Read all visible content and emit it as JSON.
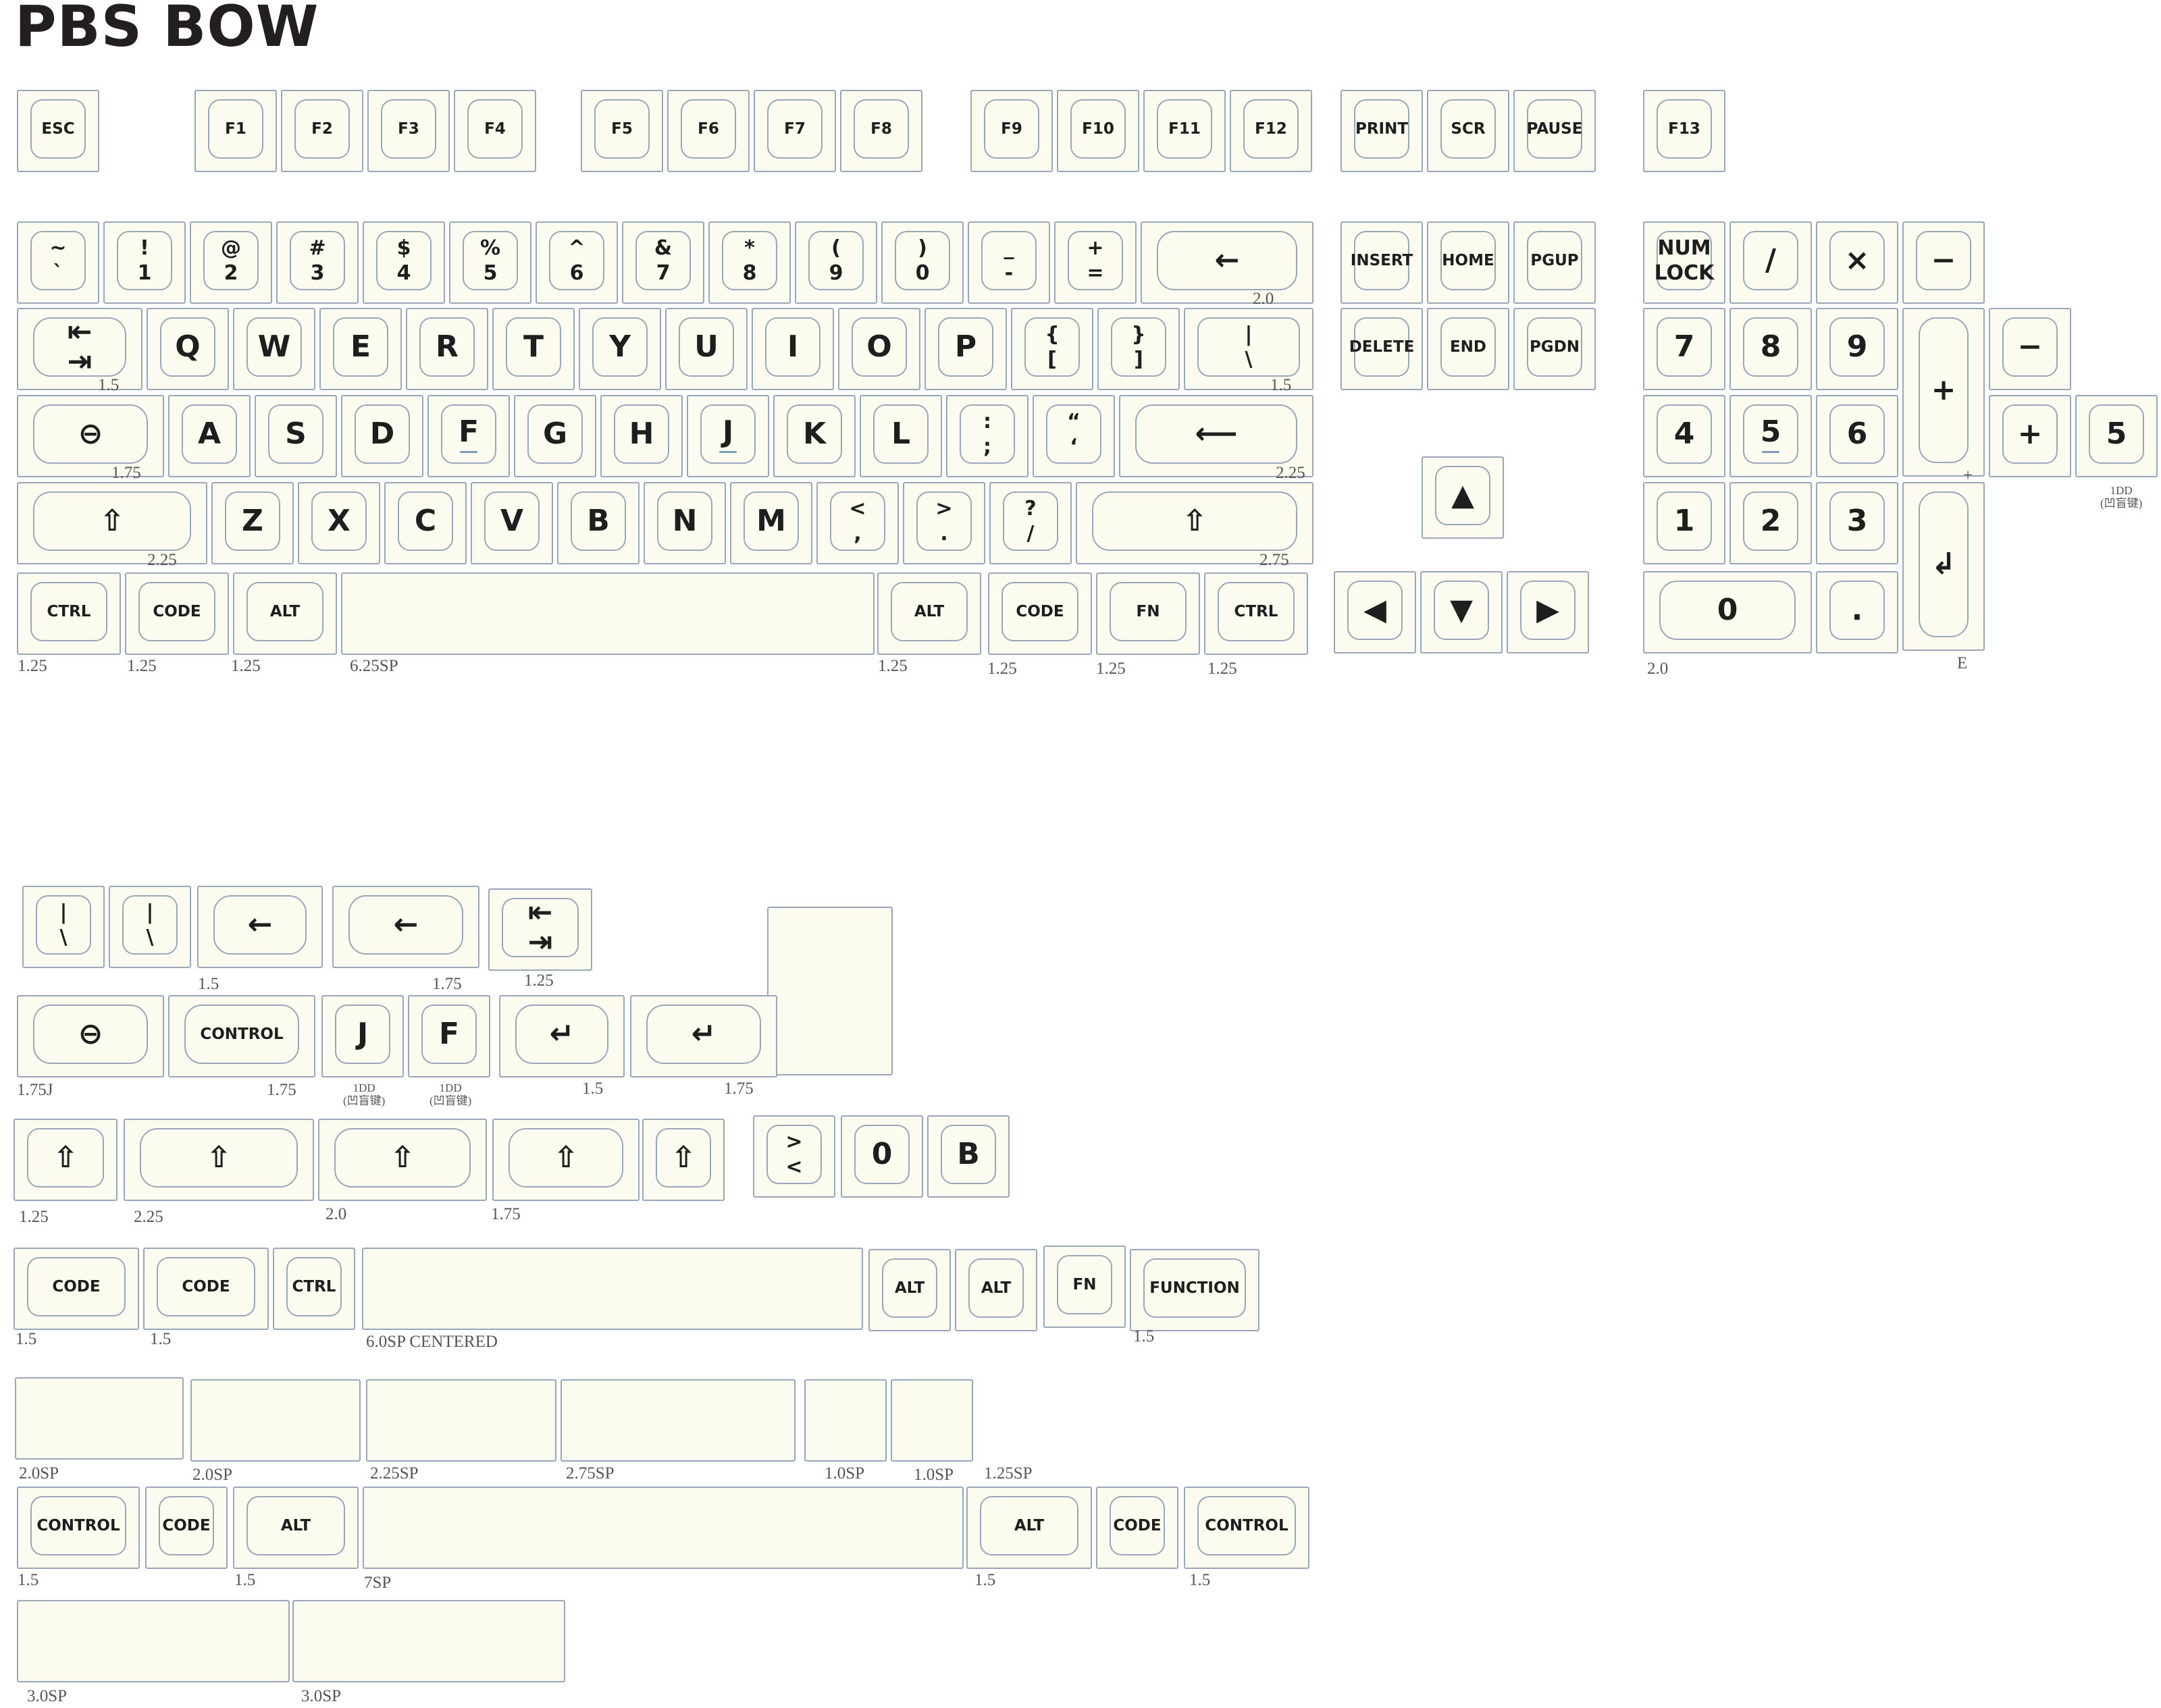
{
  "title": "PBS BOW",
  "colors": {
    "keycap": "#fcfbf0",
    "outline": "#9aa7b8",
    "homing_bar": "#7e9bb8",
    "text": "#1e1e1e"
  },
  "icons": {
    "shift": "⇧",
    "backspace": "←",
    "enter": "↵",
    "enter_long": "⟵",
    "tab_top": "⇤",
    "tab_bottom": "⇥",
    "caps_lock": "⊖",
    "arrow_up": "▲",
    "arrow_down": "▼",
    "arrow_left": "◀",
    "arrow_right": "▶",
    "numpad_enter": "↲"
  },
  "keys": [
    {
      "legends": [
        "ESC"
      ],
      "icon_name": "",
      "homing": false
    },
    {
      "legends": [
        "F1"
      ],
      "icon_name": "",
      "homing": false
    },
    {
      "legends": [
        "F2"
      ],
      "icon_name": "",
      "homing": false
    },
    {
      "legends": [
        "F3"
      ],
      "icon_name": "",
      "homing": false
    },
    {
      "legends": [
        "F4"
      ],
      "icon_name": "",
      "homing": false
    },
    {
      "legends": [
        "F5"
      ],
      "icon_name": "",
      "homing": false
    },
    {
      "legends": [
        "F6"
      ],
      "icon_name": "",
      "homing": false
    },
    {
      "legends": [
        "F7"
      ],
      "icon_name": "",
      "homing": false
    },
    {
      "legends": [
        "F8"
      ],
      "icon_name": "",
      "homing": false
    },
    {
      "legends": [
        "F9"
      ],
      "icon_name": "",
      "homing": false
    },
    {
      "legends": [
        "F10"
      ],
      "icon_name": "",
      "homing": false
    },
    {
      "legends": [
        "F11"
      ],
      "icon_name": "",
      "homing": false
    },
    {
      "legends": [
        "F12"
      ],
      "icon_name": "",
      "homing": false
    },
    {
      "legends": [
        "PRINT"
      ],
      "icon_name": "",
      "homing": false
    },
    {
      "legends": [
        "SCR"
      ],
      "icon_name": "",
      "homing": false
    },
    {
      "legends": [
        "PAUSE"
      ],
      "icon_name": "",
      "homing": false
    },
    {
      "legends": [
        "F13"
      ],
      "icon_name": "",
      "homing": false
    },
    {
      "legends": [
        "~",
        "`"
      ],
      "icon_name": "",
      "homing": false
    },
    {
      "legends": [
        "!",
        "1"
      ],
      "icon_name": "",
      "homing": false
    },
    {
      "legends": [
        "@",
        "2"
      ],
      "icon_name": "",
      "homing": false
    },
    {
      "legends": [
        "#",
        "3"
      ],
      "icon_name": "",
      "homing": false
    },
    {
      "legends": [
        "$",
        "4"
      ],
      "icon_name": "",
      "homing": false
    },
    {
      "legends": [
        "%",
        "5"
      ],
      "icon_name": "",
      "homing": false
    },
    {
      "legends": [
        "^",
        "6"
      ],
      "icon_name": "",
      "homing": false
    },
    {
      "legends": [
        "&",
        "7"
      ],
      "icon_name": "",
      "homing": false
    },
    {
      "legends": [
        "*",
        "8"
      ],
      "icon_name": "",
      "homing": false
    },
    {
      "legends": [
        "(",
        "9"
      ],
      "icon_name": "",
      "homing": false
    },
    {
      "legends": [
        ")",
        "0"
      ],
      "icon_name": "",
      "homing": false
    },
    {
      "legends": [
        "_",
        "-"
      ],
      "icon_name": "",
      "homing": false
    },
    {
      "legends": [
        "+",
        "="
      ],
      "icon_name": "",
      "homing": false
    },
    {
      "legends": [
        "←"
      ],
      "icon_name": "backspace-icon",
      "homing": false
    },
    {
      "legends": [
        "INSERT"
      ],
      "icon_name": "",
      "homing": false
    },
    {
      "legends": [
        "HOME"
      ],
      "icon_name": "",
      "homing": false
    },
    {
      "legends": [
        "PGUP"
      ],
      "icon_name": "",
      "homing": false
    },
    {
      "legends": [
        "NUM",
        "LOCK"
      ],
      "icon_name": "",
      "homing": false
    },
    {
      "legends": [
        "/"
      ],
      "icon_name": "",
      "homing": false
    },
    {
      "legends": [
        "×"
      ],
      "icon_name": "",
      "homing": false
    },
    {
      "legends": [
        "−"
      ],
      "icon_name": "",
      "homing": false
    },
    {
      "legends": [
        "⇤",
        "⇥"
      ],
      "icon_name": "tab-icon",
      "homing": false
    },
    {
      "legends": [
        "Q"
      ],
      "icon_name": "",
      "homing": false
    },
    {
      "legends": [
        "W"
      ],
      "icon_name": "",
      "homing": false
    },
    {
      "legends": [
        "E"
      ],
      "icon_name": "",
      "homing": false
    },
    {
      "legends": [
        "R"
      ],
      "icon_name": "",
      "homing": false
    },
    {
      "legends": [
        "T"
      ],
      "icon_name": "",
      "homing": false
    },
    {
      "legends": [
        "Y"
      ],
      "icon_name": "",
      "homing": false
    },
    {
      "legends": [
        "U"
      ],
      "icon_name": "",
      "homing": false
    },
    {
      "legends": [
        "I"
      ],
      "icon_name": "",
      "homing": false
    },
    {
      "legends": [
        "O"
      ],
      "icon_name": "",
      "homing": false
    },
    {
      "legends": [
        "P"
      ],
      "icon_name": "",
      "homing": false
    },
    {
      "legends": [
        "{",
        "["
      ],
      "icon_name": "",
      "homing": false
    },
    {
      "legends": [
        "}",
        "]"
      ],
      "icon_name": "",
      "homing": false
    },
    {
      "legends": [
        "|",
        "\\"
      ],
      "icon_name": "",
      "homing": false
    },
    {
      "legends": [
        "DELETE"
      ],
      "icon_name": "",
      "homing": false
    },
    {
      "legends": [
        "END"
      ],
      "icon_name": "",
      "homing": false
    },
    {
      "legends": [
        "PGDN"
      ],
      "icon_name": "",
      "homing": false
    },
    {
      "legends": [
        "7"
      ],
      "icon_name": "",
      "homing": false
    },
    {
      "legends": [
        "8"
      ],
      "icon_name": "",
      "homing": false
    },
    {
      "legends": [
        "9"
      ],
      "icon_name": "",
      "homing": false
    },
    {
      "legends": [
        "+"
      ],
      "icon_name": "",
      "homing": false
    },
    {
      "legends": [
        "−"
      ],
      "icon_name": "",
      "homing": false
    },
    {
      "legends": [
        "⊖"
      ],
      "icon_name": "caps-lock-icon",
      "homing": false
    },
    {
      "legends": [
        "A"
      ],
      "icon_name": "",
      "homing": false
    },
    {
      "legends": [
        "S"
      ],
      "icon_name": "",
      "homing": false
    },
    {
      "legends": [
        "D"
      ],
      "icon_name": "",
      "homing": false
    },
    {
      "legends": [
        "F"
      ],
      "icon_name": "",
      "homing": true
    },
    {
      "legends": [
        "G"
      ],
      "icon_name": "",
      "homing": false
    },
    {
      "legends": [
        "H"
      ],
      "icon_name": "",
      "homing": false
    },
    {
      "legends": [
        "J"
      ],
      "icon_name": "",
      "homing": true
    },
    {
      "legends": [
        "K"
      ],
      "icon_name": "",
      "homing": false
    },
    {
      "legends": [
        "L"
      ],
      "icon_name": "",
      "homing": false
    },
    {
      "legends": [
        ":",
        ";"
      ],
      "icon_name": "",
      "homing": false
    },
    {
      "legends": [
        "“",
        "‘"
      ],
      "icon_name": "",
      "homing": false
    },
    {
      "legends": [
        "⟵"
      ],
      "icon_name": "enter-icon",
      "homing": false
    },
    {
      "legends": [
        "4"
      ],
      "icon_name": "",
      "homing": false
    },
    {
      "legends": [
        "5"
      ],
      "icon_name": "",
      "homing": true
    },
    {
      "legends": [
        "6"
      ],
      "icon_name": "",
      "homing": false
    },
    {
      "legends": [
        "+"
      ],
      "icon_name": "",
      "homing": false
    },
    {
      "legends": [
        "5"
      ],
      "icon_name": "",
      "homing": false
    },
    {
      "legends": [
        "⇧"
      ],
      "icon_name": "shift-icon",
      "homing": false
    },
    {
      "legends": [
        "Z"
      ],
      "icon_name": "",
      "homing": false
    },
    {
      "legends": [
        "X"
      ],
      "icon_name": "",
      "homing": false
    },
    {
      "legends": [
        "C"
      ],
      "icon_name": "",
      "homing": false
    },
    {
      "legends": [
        "V"
      ],
      "icon_name": "",
      "homing": false
    },
    {
      "legends": [
        "B"
      ],
      "icon_name": "",
      "homing": false
    },
    {
      "legends": [
        "N"
      ],
      "icon_name": "",
      "homing": false
    },
    {
      "legends": [
        "M"
      ],
      "icon_name": "",
      "homing": false
    },
    {
      "legends": [
        "<",
        ","
      ],
      "icon_name": "",
      "homing": false
    },
    {
      "legends": [
        ">",
        "."
      ],
      "icon_name": "",
      "homing": false
    },
    {
      "legends": [
        "?",
        "/"
      ],
      "icon_name": "",
      "homing": false
    },
    {
      "legends": [
        "⇧"
      ],
      "icon_name": "shift-icon",
      "homing": false
    },
    {
      "legends": [
        "▲"
      ],
      "icon_name": "arrow-up-icon",
      "homing": false
    },
    {
      "legends": [
        "1"
      ],
      "icon_name": "",
      "homing": false
    },
    {
      "legends": [
        "2"
      ],
      "icon_name": "",
      "homing": false
    },
    {
      "legends": [
        "3"
      ],
      "icon_name": "",
      "homing": false
    },
    {
      "legends": [
        "↲"
      ],
      "icon_name": "numpad-enter-icon",
      "homing": false
    },
    {
      "legends": [
        "CTRL"
      ],
      "icon_name": "",
      "homing": false
    },
    {
      "legends": [
        "CODE"
      ],
      "icon_name": "",
      "homing": false
    },
    {
      "legends": [
        "ALT"
      ],
      "icon_name": "",
      "homing": false
    },
    {
      "legends": [],
      "icon_name": "",
      "homing": false
    },
    {
      "legends": [
        "ALT"
      ],
      "icon_name": "",
      "homing": false
    },
    {
      "legends": [
        "CODE"
      ],
      "icon_name": "",
      "homing": false
    },
    {
      "legends": [
        "FN"
      ],
      "icon_name": "",
      "homing": false
    },
    {
      "legends": [
        "CTRL"
      ],
      "icon_name": "",
      "homing": false
    },
    {
      "legends": [
        "◀"
      ],
      "icon_name": "arrow-left-icon",
      "homing": false
    },
    {
      "legends": [
        "▼"
      ],
      "icon_name": "arrow-down-icon",
      "homing": false
    },
    {
      "legends": [
        "▶"
      ],
      "icon_name": "arrow-right-icon",
      "homing": false
    },
    {
      "legends": [
        "0"
      ],
      "icon_name": "",
      "homing": false
    },
    {
      "legends": [
        "."
      ],
      "icon_name": "",
      "homing": false
    },
    {
      "legends": [
        "|",
        "\\"
      ],
      "icon_name": "",
      "homing": false
    },
    {
      "legends": [
        "|",
        "\\"
      ],
      "icon_name": "",
      "homing": false
    },
    {
      "legends": [
        "←"
      ],
      "icon_name": "backspace-icon",
      "homing": false
    },
    {
      "legends": [
        "←"
      ],
      "icon_name": "backspace-icon",
      "homing": false
    },
    {
      "legends": [
        "⇤",
        "⇥"
      ],
      "icon_name": "tab-icon",
      "homing": false
    },
    {
      "legends": [
        "↲"
      ],
      "icon_name": "iso-enter-icon",
      "homing": false
    },
    {
      "legends": [
        "⊖"
      ],
      "icon_name": "caps-lock-icon",
      "homing": false
    },
    {
      "legends": [
        "CONTROL"
      ],
      "icon_name": "",
      "homing": false
    },
    {
      "legends": [
        "J"
      ],
      "icon_name": "",
      "homing": false
    },
    {
      "legends": [
        "F"
      ],
      "icon_name": "",
      "homing": false
    },
    {
      "legends": [
        "↵"
      ],
      "icon_name": "enter-icon",
      "homing": false
    },
    {
      "legends": [
        "↵"
      ],
      "icon_name": "enter-icon",
      "homing": false
    },
    {
      "legends": [
        "⇧"
      ],
      "icon_name": "shift-icon",
      "homing": false
    },
    {
      "legends": [
        "⇧"
      ],
      "icon_name": "shift-icon",
      "homing": false
    },
    {
      "legends": [
        "⇧"
      ],
      "icon_name": "shift-icon",
      "homing": false
    },
    {
      "legends": [
        "⇧"
      ],
      "icon_name": "shift-icon",
      "homing": false
    },
    {
      "legends": [
        "⇧"
      ],
      "icon_name": "shift-icon",
      "homing": false
    },
    {
      "legends": [
        ">",
        "<"
      ],
      "icon_name": "",
      "homing": false
    },
    {
      "legends": [
        "0"
      ],
      "icon_name": "",
      "homing": false
    },
    {
      "legends": [
        "B"
      ],
      "icon_name": "",
      "homing": false
    },
    {
      "legends": [
        "CODE"
      ],
      "icon_name": "",
      "homing": false
    },
    {
      "legends": [
        "CODE"
      ],
      "icon_name": "",
      "homing": false
    },
    {
      "legends": [
        "CTRL"
      ],
      "icon_name": "",
      "homing": false
    },
    {
      "legends": [],
      "icon_name": "",
      "homing": false
    },
    {
      "legends": [
        "ALT"
      ],
      "icon_name": "",
      "homing": false
    },
    {
      "legends": [
        "ALT"
      ],
      "icon_name": "",
      "homing": false
    },
    {
      "legends": [
        "FN"
      ],
      "icon_name": "",
      "homing": false
    },
    {
      "legends": [
        "FUNCTION"
      ],
      "icon_name": "",
      "homing": false
    },
    {
      "legends": [],
      "icon_name": "",
      "homing": false
    },
    {
      "legends": [],
      "icon_name": "",
      "homing": false
    },
    {
      "legends": [],
      "icon_name": "",
      "homing": false
    },
    {
      "legends": [],
      "icon_name": "",
      "homing": false
    },
    {
      "legends": [],
      "icon_name": "",
      "homing": false
    },
    {
      "legends": [],
      "icon_name": "",
      "homing": false
    },
    {
      "legends": [
        "CONTROL"
      ],
      "icon_name": "",
      "homing": false
    },
    {
      "legends": [
        "CODE"
      ],
      "icon_name": "",
      "homing": false
    },
    {
      "legends": [
        "ALT"
      ],
      "icon_name": "",
      "homing": false
    },
    {
      "legends": [],
      "icon_name": "",
      "homing": false
    },
    {
      "legends": [
        "ALT"
      ],
      "icon_name": "",
      "homing": false
    },
    {
      "legends": [
        "CODE"
      ],
      "icon_name": "",
      "homing": false
    },
    {
      "legends": [
        "CONTROL"
      ],
      "icon_name": "",
      "homing": false
    },
    {
      "legends": [],
      "icon_name": "",
      "homing": false
    },
    {
      "legends": [],
      "icon_name": "",
      "homing": false
    }
  ],
  "notes": [
    "2.0",
    "1.5",
    "1.5",
    "1.75",
    "2.25",
    "2.25",
    "2.75",
    "+",
    "1.25",
    "1.25",
    "1.25",
    "6.25SP",
    "1.25",
    "1.25",
    "1.25",
    "1.25",
    "2.0",
    "E",
    "1DD\n(凹盲键)",
    "1.5",
    "1.75",
    "1.25",
    "1.75J",
    "1.75",
    "1DD\n(凹盲键)",
    "1DD\n(凹盲键)",
    "1.5",
    "1.75",
    "1.25",
    "2.25",
    "2.0",
    "1.75",
    "1.5",
    "1.5",
    "6.0SP CENTERED",
    "1.5",
    "2.0SP",
    "2.0SP",
    "2.25SP",
    "2.75SP",
    "1.0SP",
    "1.0SP",
    "1.25SP",
    "1.5",
    "1.5",
    "7SP",
    "1.5",
    "1.5",
    "3.0SP",
    "3.0SP"
  ]
}
